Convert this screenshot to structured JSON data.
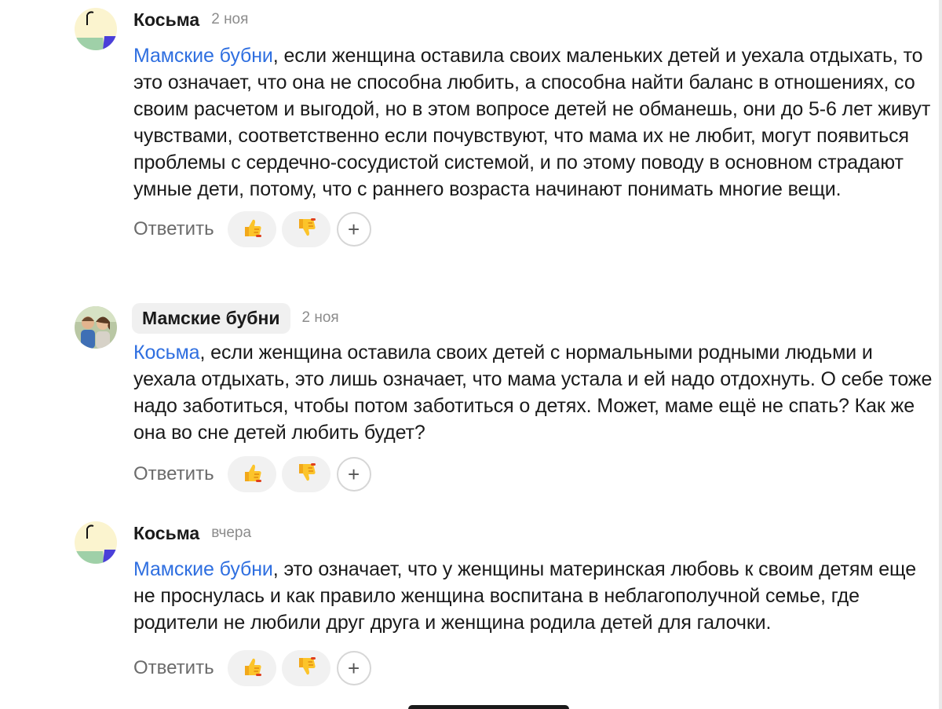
{
  "comments": [
    {
      "author": "Косьма",
      "date": "2 ноя",
      "mention": "Мамские бубни",
      "text": ", если женщина оставила своих маленьких детей и уехала отдыхать, то это означает, что она не способна любить, а способна найти баланс в отношениях, со своим расчетом и выгодой, но в этом вопросе детей не обманешь, они до 5-6 лет живут чувствами, соответственно если почувствуют, что мама их не любит, могут появиться проблемы с сердечно-сосудистой системой, и по этому поводу в основном страдают умные дети, потому, что с раннего возраста начинают понимать многие вещи.",
      "reply_label": "Ответить",
      "like_icon": "thumbs-up-icon",
      "dislike_icon": "thumbs-down-icon",
      "add_reaction": "+"
    },
    {
      "author": "Мамские бубни",
      "date": "2 ноя",
      "mention": "Косьма",
      "text": ", если женщина оставила своих детей с нормальными родными людьми и уехала отдыхать, это лишь означает, что мама устала и ей надо отдохнуть. О себе тоже надо заботиться, чтобы потом заботиться о детях. Может, маме ещё не спать? Как же она во сне детей любить будет?",
      "reply_label": "Ответить",
      "like_icon": "thumbs-up-icon",
      "dislike_icon": "thumbs-down-icon",
      "add_reaction": "+"
    },
    {
      "author": "Косьма",
      "date": "вчера",
      "mention": "Мамские бубни",
      "text": ", это означает, что у женщины материнская любовь к своим детям еще не проснулась и как правило женщина воспитана в неблагополучной семье, где родители не любили друг друга и женщина родила детей для галочки.",
      "reply_label": "Ответить",
      "like_icon": "thumbs-up-icon",
      "dislike_icon": "thumbs-down-icon",
      "add_reaction": "+"
    }
  ],
  "colors": {
    "mention": "#2f6fe0",
    "reaction_bg": "#f1f1f1",
    "date": "#8c8c8c"
  }
}
